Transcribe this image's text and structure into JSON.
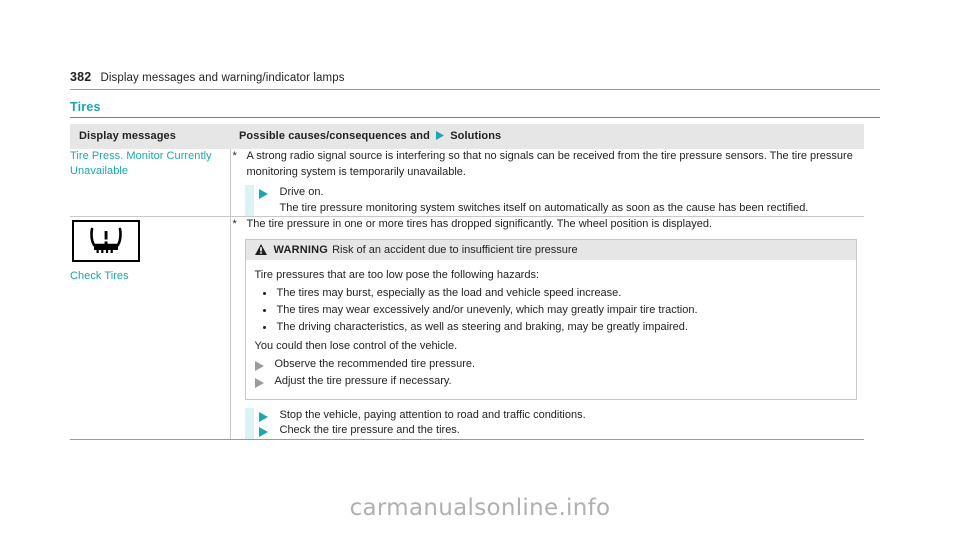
{
  "page": {
    "number": "382",
    "running_head": "Display messages and warning/indicator lamps",
    "section_heading": "Tires",
    "watermark": "carmanualsonline.info"
  },
  "colors": {
    "accent_teal": "#1ba7ac",
    "action_band": "#d9f4f4",
    "header_gray": "#e6e6e6",
    "rule_gray": "#c8c8c8"
  },
  "table": {
    "columns": {
      "display_messages": "Display messages",
      "causes_prefix": "Possible causes/consequences and",
      "causes_suffix": "Solutions"
    },
    "rows": [
      {
        "message": "Tire Press. Monitor Currently Unavailable",
        "star_marker": "*",
        "cause": "A strong radio signal source is interfering so that no signals can be received from the tire pressure sensors. The tire pressure monitoring system is temporarily unavailable.",
        "solution": "Drive on.",
        "solution_detail": "The tire pressure monitoring system switches itself on automatically as soon as the cause has been rectified."
      },
      {
        "icon_name": "tire-pressure-warning-lamp",
        "message": "Check Tires",
        "star_marker": "*",
        "cause": "The tire pressure in one or more tires has dropped significantly. The wheel position is displayed.",
        "warning": {
          "label": "WARNING",
          "title": "Risk of an accident due to insufficient tire pressure",
          "lead": "Tire pressures that are too low pose the following hazards:",
          "hazards": [
            "The tires may burst, especially as the load and vehicle speed increase.",
            "The tires may wear excessively and/or unevenly, which may greatly impair tire traction.",
            "The driving characteristics, as well as steering and braking, may be greatly impaired."
          ],
          "tail": "You could then lose control of the vehicle.",
          "actions": [
            "Observe the recommended tire pressure.",
            "Adjust the tire pressure if necessary."
          ]
        },
        "solutions": [
          "Stop the vehicle, paying attention to road and traffic conditions.",
          "Check the tire pressure and the tires."
        ]
      }
    ]
  }
}
